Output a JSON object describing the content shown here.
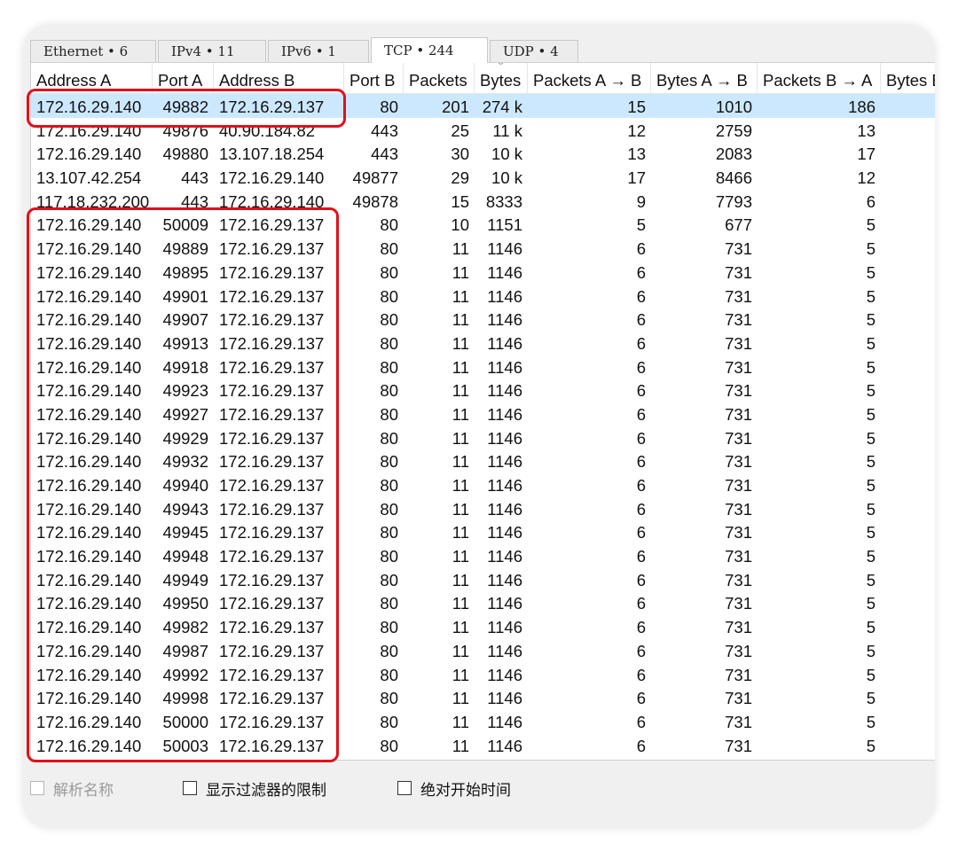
{
  "tabs": [
    {
      "label": "Ethernet • 6",
      "active": false
    },
    {
      "label": "IPv4 • 11",
      "active": false
    },
    {
      "label": "IPv6 • 1",
      "active": false
    },
    {
      "label": "TCP • 244",
      "active": true
    },
    {
      "label": "UDP • 4",
      "active": false
    }
  ],
  "columns": [
    "Address A",
    "Port A",
    "Address B",
    "Port B",
    "Packets",
    "Bytes",
    "Packets A → B",
    "Bytes A → B",
    "Packets B → A",
    "Bytes B"
  ],
  "sort_indicator": "﹀",
  "rows": [
    [
      "172.16.29.140",
      "49882",
      "172.16.29.137",
      "80",
      "201",
      "274 k",
      "15",
      "1010",
      "186"
    ],
    [
      "172.16.29.140",
      "49876",
      "40.90.184.82",
      "443",
      "25",
      "11 k",
      "12",
      "2759",
      "13"
    ],
    [
      "172.16.29.140",
      "49880",
      "13.107.18.254",
      "443",
      "30",
      "10 k",
      "13",
      "2083",
      "17"
    ],
    [
      "13.107.42.254",
      "443",
      "172.16.29.140",
      "49877",
      "29",
      "10 k",
      "17",
      "8466",
      "12"
    ],
    [
      "117.18.232.200",
      "443",
      "172.16.29.140",
      "49878",
      "15",
      "8333",
      "9",
      "7793",
      "6"
    ],
    [
      "172.16.29.140",
      "50009",
      "172.16.29.137",
      "80",
      "10",
      "1151",
      "5",
      "677",
      "5"
    ],
    [
      "172.16.29.140",
      "49889",
      "172.16.29.137",
      "80",
      "11",
      "1146",
      "6",
      "731",
      "5"
    ],
    [
      "172.16.29.140",
      "49895",
      "172.16.29.137",
      "80",
      "11",
      "1146",
      "6",
      "731",
      "5"
    ],
    [
      "172.16.29.140",
      "49901",
      "172.16.29.137",
      "80",
      "11",
      "1146",
      "6",
      "731",
      "5"
    ],
    [
      "172.16.29.140",
      "49907",
      "172.16.29.137",
      "80",
      "11",
      "1146",
      "6",
      "731",
      "5"
    ],
    [
      "172.16.29.140",
      "49913",
      "172.16.29.137",
      "80",
      "11",
      "1146",
      "6",
      "731",
      "5"
    ],
    [
      "172.16.29.140",
      "49918",
      "172.16.29.137",
      "80",
      "11",
      "1146",
      "6",
      "731",
      "5"
    ],
    [
      "172.16.29.140",
      "49923",
      "172.16.29.137",
      "80",
      "11",
      "1146",
      "6",
      "731",
      "5"
    ],
    [
      "172.16.29.140",
      "49927",
      "172.16.29.137",
      "80",
      "11",
      "1146",
      "6",
      "731",
      "5"
    ],
    [
      "172.16.29.140",
      "49929",
      "172.16.29.137",
      "80",
      "11",
      "1146",
      "6",
      "731",
      "5"
    ],
    [
      "172.16.29.140",
      "49932",
      "172.16.29.137",
      "80",
      "11",
      "1146",
      "6",
      "731",
      "5"
    ],
    [
      "172.16.29.140",
      "49940",
      "172.16.29.137",
      "80",
      "11",
      "1146",
      "6",
      "731",
      "5"
    ],
    [
      "172.16.29.140",
      "49943",
      "172.16.29.137",
      "80",
      "11",
      "1146",
      "6",
      "731",
      "5"
    ],
    [
      "172.16.29.140",
      "49945",
      "172.16.29.137",
      "80",
      "11",
      "1146",
      "6",
      "731",
      "5"
    ],
    [
      "172.16.29.140",
      "49948",
      "172.16.29.137",
      "80",
      "11",
      "1146",
      "6",
      "731",
      "5"
    ],
    [
      "172.16.29.140",
      "49949",
      "172.16.29.137",
      "80",
      "11",
      "1146",
      "6",
      "731",
      "5"
    ],
    [
      "172.16.29.140",
      "49950",
      "172.16.29.137",
      "80",
      "11",
      "1146",
      "6",
      "731",
      "5"
    ],
    [
      "172.16.29.140",
      "49982",
      "172.16.29.137",
      "80",
      "11",
      "1146",
      "6",
      "731",
      "5"
    ],
    [
      "172.16.29.140",
      "49987",
      "172.16.29.137",
      "80",
      "11",
      "1146",
      "6",
      "731",
      "5"
    ],
    [
      "172.16.29.140",
      "49992",
      "172.16.29.137",
      "80",
      "11",
      "1146",
      "6",
      "731",
      "5"
    ],
    [
      "172.16.29.140",
      "49998",
      "172.16.29.137",
      "80",
      "11",
      "1146",
      "6",
      "731",
      "5"
    ],
    [
      "172.16.29.140",
      "50000",
      "172.16.29.137",
      "80",
      "11",
      "1146",
      "6",
      "731",
      "5"
    ],
    [
      "172.16.29.140",
      "50003",
      "172.16.29.137",
      "80",
      "11",
      "1146",
      "6",
      "731",
      "5"
    ]
  ],
  "selected_row": 0,
  "footer": {
    "resolve_names": {
      "label": "解析名称",
      "checked": false,
      "enabled": false
    },
    "limit_to_filter": {
      "label": "显示过滤器的限制",
      "checked": false,
      "enabled": true
    },
    "absolute_start_time": {
      "label": "绝对开始时间",
      "checked": false,
      "enabled": true
    }
  },
  "colors": {
    "highlight": "#e0101b",
    "selection": "#cce8ff"
  }
}
